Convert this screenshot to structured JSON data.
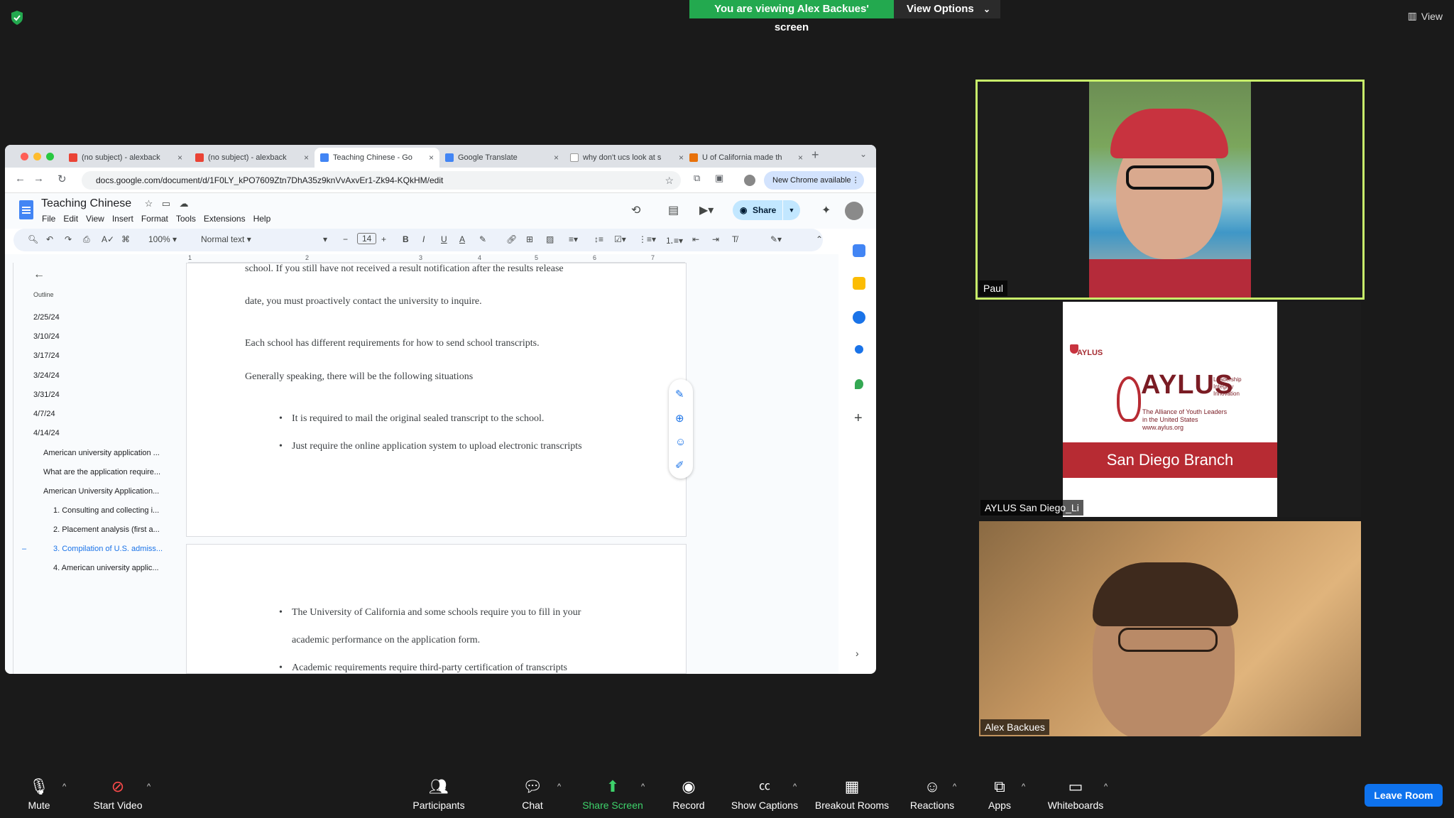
{
  "zoom": {
    "viewing_banner": "You are viewing Alex Backues' screen",
    "view_options": "View Options",
    "view": "View",
    "participants": [
      {
        "name": "Paul"
      },
      {
        "name": "AYLUS San Diego_Li"
      },
      {
        "name": "Alex Backues"
      }
    ],
    "toolbar": {
      "mute": "Mute",
      "start_video": "Start Video",
      "participants": "Participants",
      "participants_count": "3",
      "chat": "Chat",
      "share_screen": "Share Screen",
      "record": "Record",
      "show_captions": "Show Captions",
      "breakout_rooms": "Breakout Rooms",
      "reactions": "Reactions",
      "apps": "Apps",
      "whiteboards": "Whiteboards",
      "leave_room": "Leave Room"
    },
    "accent_green": "#23a94f",
    "leave_blue": "#0e72ed"
  },
  "aylus": {
    "small": "AYLUS",
    "name": "AYLUS",
    "tagline": [
      "Leadership",
      "Integrity",
      "Innovation"
    ],
    "subtitle": [
      "The Alliance of Youth Leaders",
      "in the United States"
    ],
    "url": "www.aylus.org",
    "branch": "San Diego Branch"
  },
  "browser": {
    "tabs": [
      {
        "title": "(no subject) - alexback"
      },
      {
        "title": "(no subject) - alexback"
      },
      {
        "title": "Teaching Chinese - Go"
      },
      {
        "title": "Google Translate"
      },
      {
        "title": "why don't ucs look at s"
      },
      {
        "title": "U of California made th"
      }
    ],
    "url": "docs.google.com/document/d/1F0LY_kPO7609Ztn7DhA35z9knVvAxvEr1-Zk94-KQkHM/edit",
    "new_chrome": "New Chrome available"
  },
  "docs": {
    "title": "Teaching Chinese",
    "menu": [
      "File",
      "Edit",
      "View",
      "Insert",
      "Format",
      "Tools",
      "Extensions",
      "Help"
    ],
    "share": "Share",
    "zoom": "100%",
    "style": "Normal text",
    "font_size": "14",
    "outline_label": "Outline",
    "outline": [
      "2/25/24",
      "3/10/24",
      "3/17/24",
      "3/24/24",
      "3/31/24",
      "4/7/24",
      "4/14/24",
      "American university application ...",
      "What are the application require...",
      "American University Application...",
      "1. Consulting and collecting i...",
      "2. Placement analysis (first a...",
      "3. Compilation of U.S. admiss...",
      "4. American university applic..."
    ],
    "page1": [
      "school. If you still have not received a result notification after the results release",
      "date, you must proactively contact the university to inquire.",
      "Each school has different requirements for how to send school transcripts.",
      "Generally speaking, there will be the following situations",
      "It is required to mail the original sealed transcript to the school.",
      "Just require the online application system to upload electronic transcripts"
    ],
    "page2": [
      "The University of California and some schools require you to fill in your",
      "academic performance on the application form.",
      "Academic requirements require third-party certification of transcripts"
    ]
  }
}
